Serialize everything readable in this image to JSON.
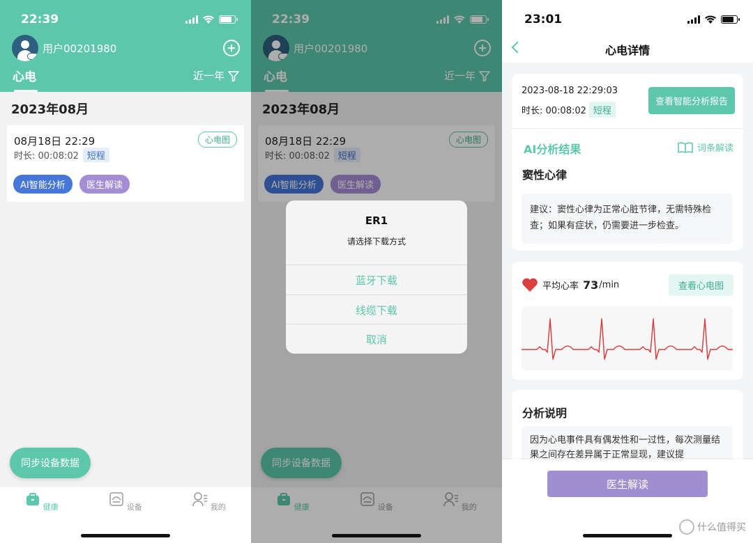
{
  "colors": {
    "accent": "#5cc7ab",
    "ai_blue": "#4576d8",
    "doctor_purple": "#a58dd6",
    "heart_red": "#d94040"
  },
  "screen1": {
    "time": "22:39",
    "username": "用户00201980",
    "tab": "心电",
    "range": "近一年",
    "month": "2023年08月",
    "record": {
      "date": "08月18日 22:29",
      "duration": "时长: 00:08:02",
      "tag": "短程",
      "ecg_pill": "心电图",
      "ai_button": "AI智能分析",
      "doctor_button": "医生解读"
    },
    "sync_button": "同步设备数据",
    "tabs": [
      "健康",
      "设备",
      "我的"
    ]
  },
  "screen2": {
    "time": "22:39",
    "username": "用户00201980",
    "tab": "心电",
    "range": "近一年",
    "month": "2023年08月",
    "record": {
      "date": "08月18日 22:29",
      "duration": "时长: 00:08:02",
      "tag": "短程",
      "ecg_pill": "心电图",
      "ai_button": "AI智能分析",
      "doctor_button": "医生解读"
    },
    "dialog": {
      "title": "ER1",
      "subtitle": "请选择下载方式",
      "options": [
        "蓝牙下载",
        "线缆下载",
        "取消"
      ]
    },
    "sync_button": "同步设备数据",
    "tabs": [
      "健康",
      "设备",
      "我的"
    ]
  },
  "screen3": {
    "time": "23:01",
    "title": "心电详情",
    "datetime": "2023-08-18 22:29:03",
    "duration": "时长: 00:08:02",
    "tag": "短程",
    "report_button": "查看智能分析报告",
    "ai_title": "AI分析结果",
    "dict_link": "词条解读",
    "rhythm": "窦性心律",
    "advice": "建议：窦性心律为正常心脏节律，无需特殊检查；如果有症状，仍需要进一步检查。",
    "hr_label": "平均心率",
    "hr_value": "73",
    "hr_unit": "/min",
    "view_ecg_button": "查看心电图",
    "analysis_title": "分析说明",
    "analysis_text": "因为心电事件具有偶发性和一过性，每次测量结果之间存在差异属于正常显现，建议提",
    "doctor_button": "医生解读"
  },
  "watermark": "什么值得买"
}
